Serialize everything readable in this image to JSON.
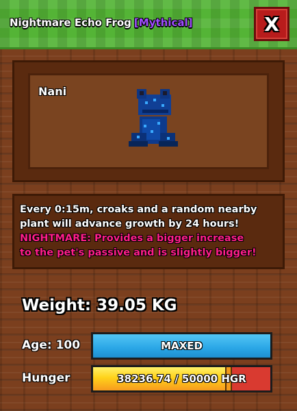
{
  "header": {
    "pet_title": "Nightmare Echo Frog",
    "rarity": "[Mythical]",
    "close_label": "X"
  },
  "preview": {
    "nickname": "Nani",
    "pet_icon": "blue-frog-icon"
  },
  "description": {
    "line1": "Every 0:15m, croaks and a random nearby",
    "line2": "plant will advance growth by 24 hours!",
    "line3": "NIGHTMARE: Provides a bigger increase",
    "line4": "to the pet's passive and is slightly bigger!"
  },
  "stats": {
    "weight": "Weight: 39.05 KG",
    "age_label": "Age: 100",
    "age_bar_text": "MAXED",
    "hunger_label": "Hunger",
    "hunger_bar_text": "38236.74 / 50000 HGR",
    "hunger_current": 38236.74,
    "hunger_max": 50000
  },
  "colors": {
    "rarity": "#a04dff",
    "nightmare_text": "#ff1e8a",
    "age_bar": "#2aa6e6",
    "hunger_fill": "#ffd21a",
    "hunger_empty": "#d93a30",
    "close_button": "#b81c1c"
  }
}
